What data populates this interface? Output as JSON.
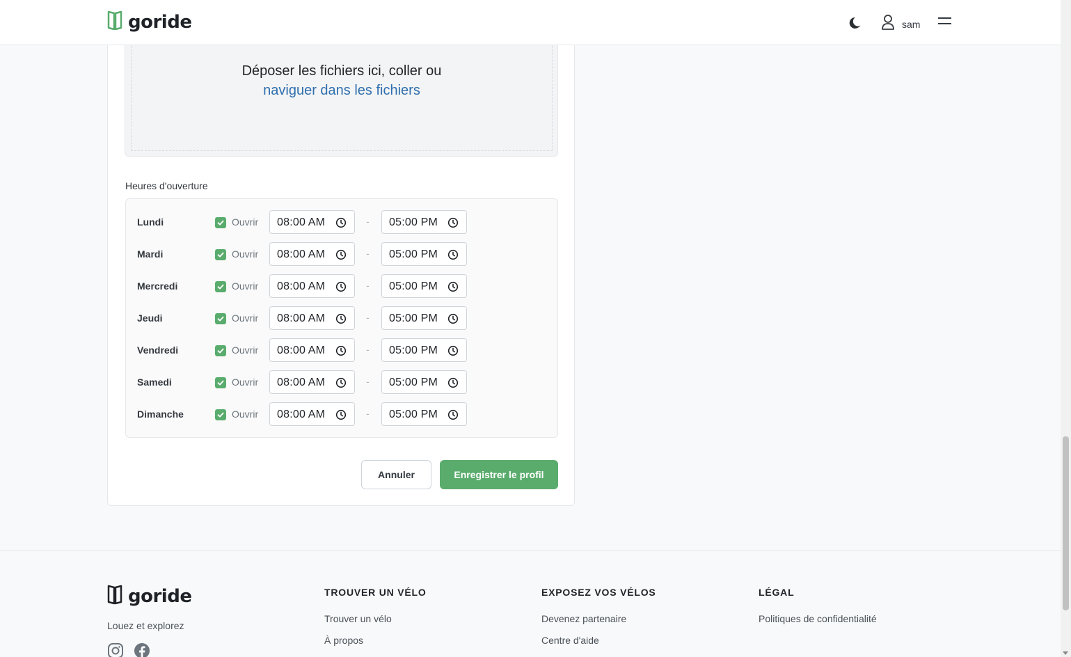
{
  "header": {
    "brand": "goride",
    "user_name": "sam",
    "icons": [
      "book-logo-icon",
      "moon-icon",
      "user-icon",
      "menu-icon"
    ]
  },
  "dropzone": {
    "text": "Déposer les fichiers ici, coller ou",
    "link": "naviguer dans les fichiers"
  },
  "hours": {
    "label": "Heures d'ouverture",
    "open_label": "Ouvrir",
    "separator": "-",
    "days": [
      {
        "day": "Lundi",
        "open": "08:00 AM",
        "close": "05:00 PM",
        "checked": true
      },
      {
        "day": "Mardi",
        "open": "08:00 AM",
        "close": "05:00 PM",
        "checked": true
      },
      {
        "day": "Mercredi",
        "open": "08:00 AM",
        "close": "05:00 PM",
        "checked": true
      },
      {
        "day": "Jeudi",
        "open": "08:00 AM",
        "close": "05:00 PM",
        "checked": true
      },
      {
        "day": "Vendredi",
        "open": "08:00 AM",
        "close": "05:00 PM",
        "checked": true
      },
      {
        "day": "Samedi",
        "open": "08:00 AM",
        "close": "05:00 PM",
        "checked": true
      },
      {
        "day": "Dimanche",
        "open": "08:00 AM",
        "close": "05:00 PM",
        "checked": true
      }
    ]
  },
  "actions": {
    "cancel": "Annuler",
    "save": "Enregistrer le profil"
  },
  "footer": {
    "brand": "goride",
    "tagline": "Louez et explorez",
    "columns": [
      {
        "title": "TROUVER UN VÉLO",
        "links": [
          "Trouver un vélo",
          "À propos"
        ]
      },
      {
        "title": "EXPOSEZ VOS VÉLOS",
        "links": [
          "Devenez partenaire",
          "Centre d'aide"
        ]
      },
      {
        "title": "LÉGAL",
        "links": [
          "Politiques de confidentialité"
        ]
      }
    ]
  },
  "colors": {
    "accent": "#5aac6d",
    "link": "#2f6fad"
  }
}
